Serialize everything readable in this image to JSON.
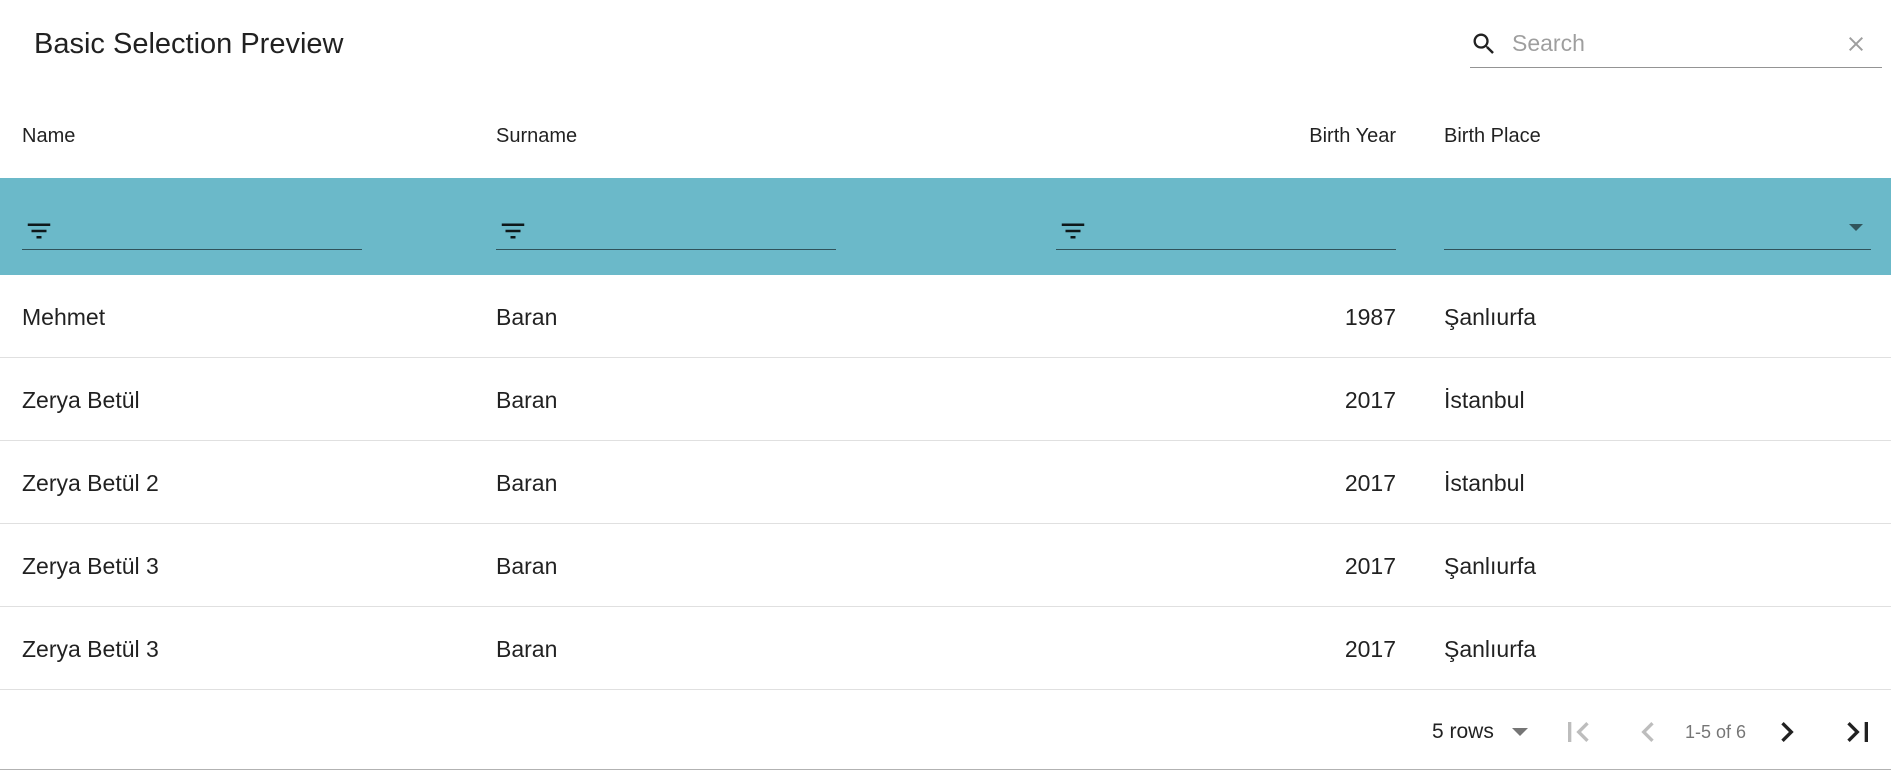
{
  "toolbar": {
    "title": "Basic Selection Preview",
    "search": {
      "placeholder": "Search",
      "value": ""
    }
  },
  "table": {
    "columns": [
      {
        "label": "Name"
      },
      {
        "label": "Surname"
      },
      {
        "label": "Birth Year"
      },
      {
        "label": "Birth Place"
      }
    ],
    "filter_row_color": "#6bb9c9",
    "rows": [
      {
        "name": "Mehmet",
        "surname": "Baran",
        "birth_year": "1987",
        "birth_place": "Şanlıurfa"
      },
      {
        "name": "Zerya Betül",
        "surname": "Baran",
        "birth_year": "2017",
        "birth_place": "İstanbul"
      },
      {
        "name": "Zerya Betül 2",
        "surname": "Baran",
        "birth_year": "2017",
        "birth_place": "İstanbul"
      },
      {
        "name": "Zerya Betül 3",
        "surname": "Baran",
        "birth_year": "2017",
        "birth_place": "Şanlıurfa"
      },
      {
        "name": "Zerya Betül 3",
        "surname": "Baran",
        "birth_year": "2017",
        "birth_place": "Şanlıurfa"
      }
    ]
  },
  "pagination": {
    "rows_per_page_label": "5 rows",
    "range_label": "1-5 of 6",
    "icons": [
      "first-page-icon",
      "previous-page-icon",
      "next-page-icon",
      "last-page-icon"
    ]
  }
}
